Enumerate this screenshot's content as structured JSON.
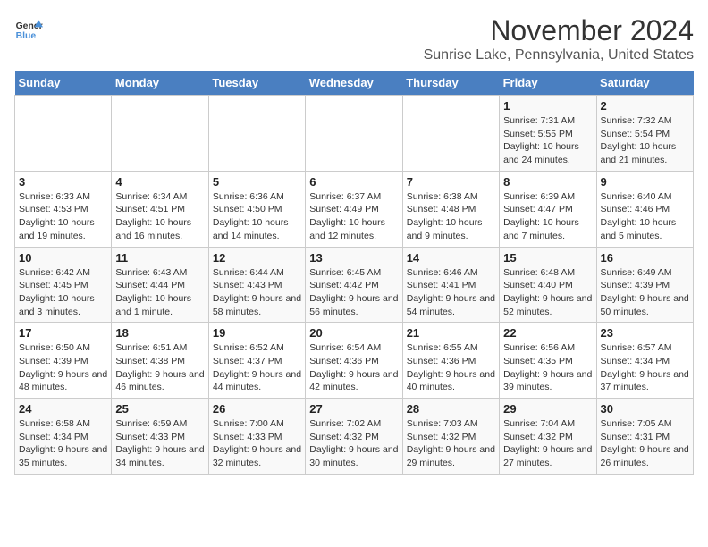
{
  "logo": {
    "line1": "General",
    "line2": "Blue"
  },
  "title": "November 2024",
  "subtitle": "Sunrise Lake, Pennsylvania, United States",
  "days_of_week": [
    "Sunday",
    "Monday",
    "Tuesday",
    "Wednesday",
    "Thursday",
    "Friday",
    "Saturday"
  ],
  "weeks": [
    [
      {
        "day": "",
        "info": ""
      },
      {
        "day": "",
        "info": ""
      },
      {
        "day": "",
        "info": ""
      },
      {
        "day": "",
        "info": ""
      },
      {
        "day": "",
        "info": ""
      },
      {
        "day": "1",
        "info": "Sunrise: 7:31 AM\nSunset: 5:55 PM\nDaylight: 10 hours and 24 minutes."
      },
      {
        "day": "2",
        "info": "Sunrise: 7:32 AM\nSunset: 5:54 PM\nDaylight: 10 hours and 21 minutes."
      }
    ],
    [
      {
        "day": "3",
        "info": "Sunrise: 6:33 AM\nSunset: 4:53 PM\nDaylight: 10 hours and 19 minutes."
      },
      {
        "day": "4",
        "info": "Sunrise: 6:34 AM\nSunset: 4:51 PM\nDaylight: 10 hours and 16 minutes."
      },
      {
        "day": "5",
        "info": "Sunrise: 6:36 AM\nSunset: 4:50 PM\nDaylight: 10 hours and 14 minutes."
      },
      {
        "day": "6",
        "info": "Sunrise: 6:37 AM\nSunset: 4:49 PM\nDaylight: 10 hours and 12 minutes."
      },
      {
        "day": "7",
        "info": "Sunrise: 6:38 AM\nSunset: 4:48 PM\nDaylight: 10 hours and 9 minutes."
      },
      {
        "day": "8",
        "info": "Sunrise: 6:39 AM\nSunset: 4:47 PM\nDaylight: 10 hours and 7 minutes."
      },
      {
        "day": "9",
        "info": "Sunrise: 6:40 AM\nSunset: 4:46 PM\nDaylight: 10 hours and 5 minutes."
      }
    ],
    [
      {
        "day": "10",
        "info": "Sunrise: 6:42 AM\nSunset: 4:45 PM\nDaylight: 10 hours and 3 minutes."
      },
      {
        "day": "11",
        "info": "Sunrise: 6:43 AM\nSunset: 4:44 PM\nDaylight: 10 hours and 1 minute."
      },
      {
        "day": "12",
        "info": "Sunrise: 6:44 AM\nSunset: 4:43 PM\nDaylight: 9 hours and 58 minutes."
      },
      {
        "day": "13",
        "info": "Sunrise: 6:45 AM\nSunset: 4:42 PM\nDaylight: 9 hours and 56 minutes."
      },
      {
        "day": "14",
        "info": "Sunrise: 6:46 AM\nSunset: 4:41 PM\nDaylight: 9 hours and 54 minutes."
      },
      {
        "day": "15",
        "info": "Sunrise: 6:48 AM\nSunset: 4:40 PM\nDaylight: 9 hours and 52 minutes."
      },
      {
        "day": "16",
        "info": "Sunrise: 6:49 AM\nSunset: 4:39 PM\nDaylight: 9 hours and 50 minutes."
      }
    ],
    [
      {
        "day": "17",
        "info": "Sunrise: 6:50 AM\nSunset: 4:39 PM\nDaylight: 9 hours and 48 minutes."
      },
      {
        "day": "18",
        "info": "Sunrise: 6:51 AM\nSunset: 4:38 PM\nDaylight: 9 hours and 46 minutes."
      },
      {
        "day": "19",
        "info": "Sunrise: 6:52 AM\nSunset: 4:37 PM\nDaylight: 9 hours and 44 minutes."
      },
      {
        "day": "20",
        "info": "Sunrise: 6:54 AM\nSunset: 4:36 PM\nDaylight: 9 hours and 42 minutes."
      },
      {
        "day": "21",
        "info": "Sunrise: 6:55 AM\nSunset: 4:36 PM\nDaylight: 9 hours and 40 minutes."
      },
      {
        "day": "22",
        "info": "Sunrise: 6:56 AM\nSunset: 4:35 PM\nDaylight: 9 hours and 39 minutes."
      },
      {
        "day": "23",
        "info": "Sunrise: 6:57 AM\nSunset: 4:34 PM\nDaylight: 9 hours and 37 minutes."
      }
    ],
    [
      {
        "day": "24",
        "info": "Sunrise: 6:58 AM\nSunset: 4:34 PM\nDaylight: 9 hours and 35 minutes."
      },
      {
        "day": "25",
        "info": "Sunrise: 6:59 AM\nSunset: 4:33 PM\nDaylight: 9 hours and 34 minutes."
      },
      {
        "day": "26",
        "info": "Sunrise: 7:00 AM\nSunset: 4:33 PM\nDaylight: 9 hours and 32 minutes."
      },
      {
        "day": "27",
        "info": "Sunrise: 7:02 AM\nSunset: 4:32 PM\nDaylight: 9 hours and 30 minutes."
      },
      {
        "day": "28",
        "info": "Sunrise: 7:03 AM\nSunset: 4:32 PM\nDaylight: 9 hours and 29 minutes."
      },
      {
        "day": "29",
        "info": "Sunrise: 7:04 AM\nSunset: 4:32 PM\nDaylight: 9 hours and 27 minutes."
      },
      {
        "day": "30",
        "info": "Sunrise: 7:05 AM\nSunset: 4:31 PM\nDaylight: 9 hours and 26 minutes."
      }
    ]
  ]
}
